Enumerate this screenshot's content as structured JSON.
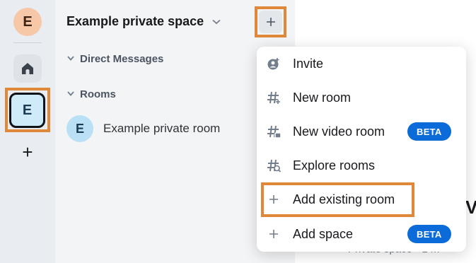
{
  "rail": {
    "user_initial": "E",
    "space_initial": "E",
    "add_glyph": "+",
    "icons": [
      "home-icon",
      "plus-icon"
    ]
  },
  "panel": {
    "space_title": "Example private space",
    "add_button_glyph": "+",
    "sections": [
      {
        "label": "Direct Messages"
      },
      {
        "label": "Rooms"
      }
    ],
    "rooms": [
      {
        "initial": "E",
        "name": "Example private room"
      }
    ]
  },
  "menu": {
    "items": [
      {
        "label": "Invite",
        "icon": "invite-icon"
      },
      {
        "label": "New room",
        "icon": "hash-plus-icon"
      },
      {
        "label": "New video room",
        "icon": "video-hash-icon",
        "badge": "BETA"
      },
      {
        "label": "Explore rooms",
        "icon": "explore-hash-icon"
      },
      {
        "label": "Add existing room",
        "icon": "plus-icon",
        "highlighted": true
      },
      {
        "label": "Add space",
        "icon": "plus-icon",
        "badge": "BETA"
      }
    ]
  },
  "background": {
    "heading_fragment": "V",
    "subtitle_fragment": "Private space · 1 m"
  },
  "colors": {
    "highlight": "#e0883a",
    "beta_badge": "#0b6bd8",
    "rail_bg": "#e9ecf0",
    "panel_bg": "#f3f4f6"
  }
}
